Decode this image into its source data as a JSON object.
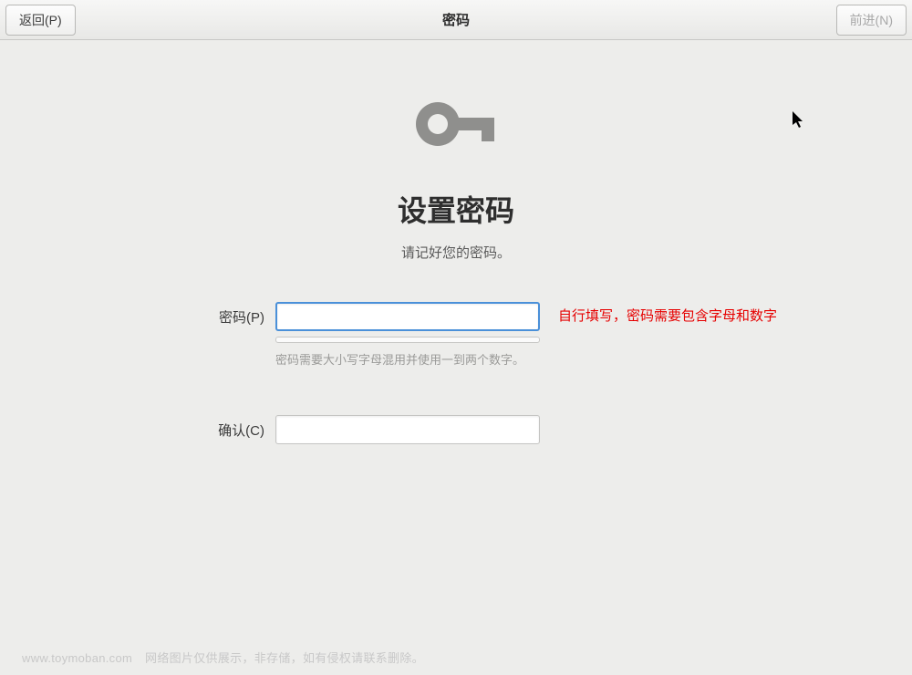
{
  "titlebar": {
    "back_label": "返回(P)",
    "title": "密码",
    "forward_label": "前进(N)"
  },
  "content": {
    "icon_name": "key-icon",
    "heading": "设置密码",
    "subtitle": "请记好您的密码。",
    "password": {
      "label": "密码(P)",
      "value": "",
      "hint": "密码需要大小写字母混用并使用一到两个数字。",
      "annotation": "自行填写，密码需要包含字母和数字"
    },
    "confirm": {
      "label": "确认(C)",
      "value": ""
    }
  },
  "footer": {
    "domain": "www.toymoban.com",
    "notice": "网络图片仅供展示，非存储，如有侵权请联系删除。"
  }
}
